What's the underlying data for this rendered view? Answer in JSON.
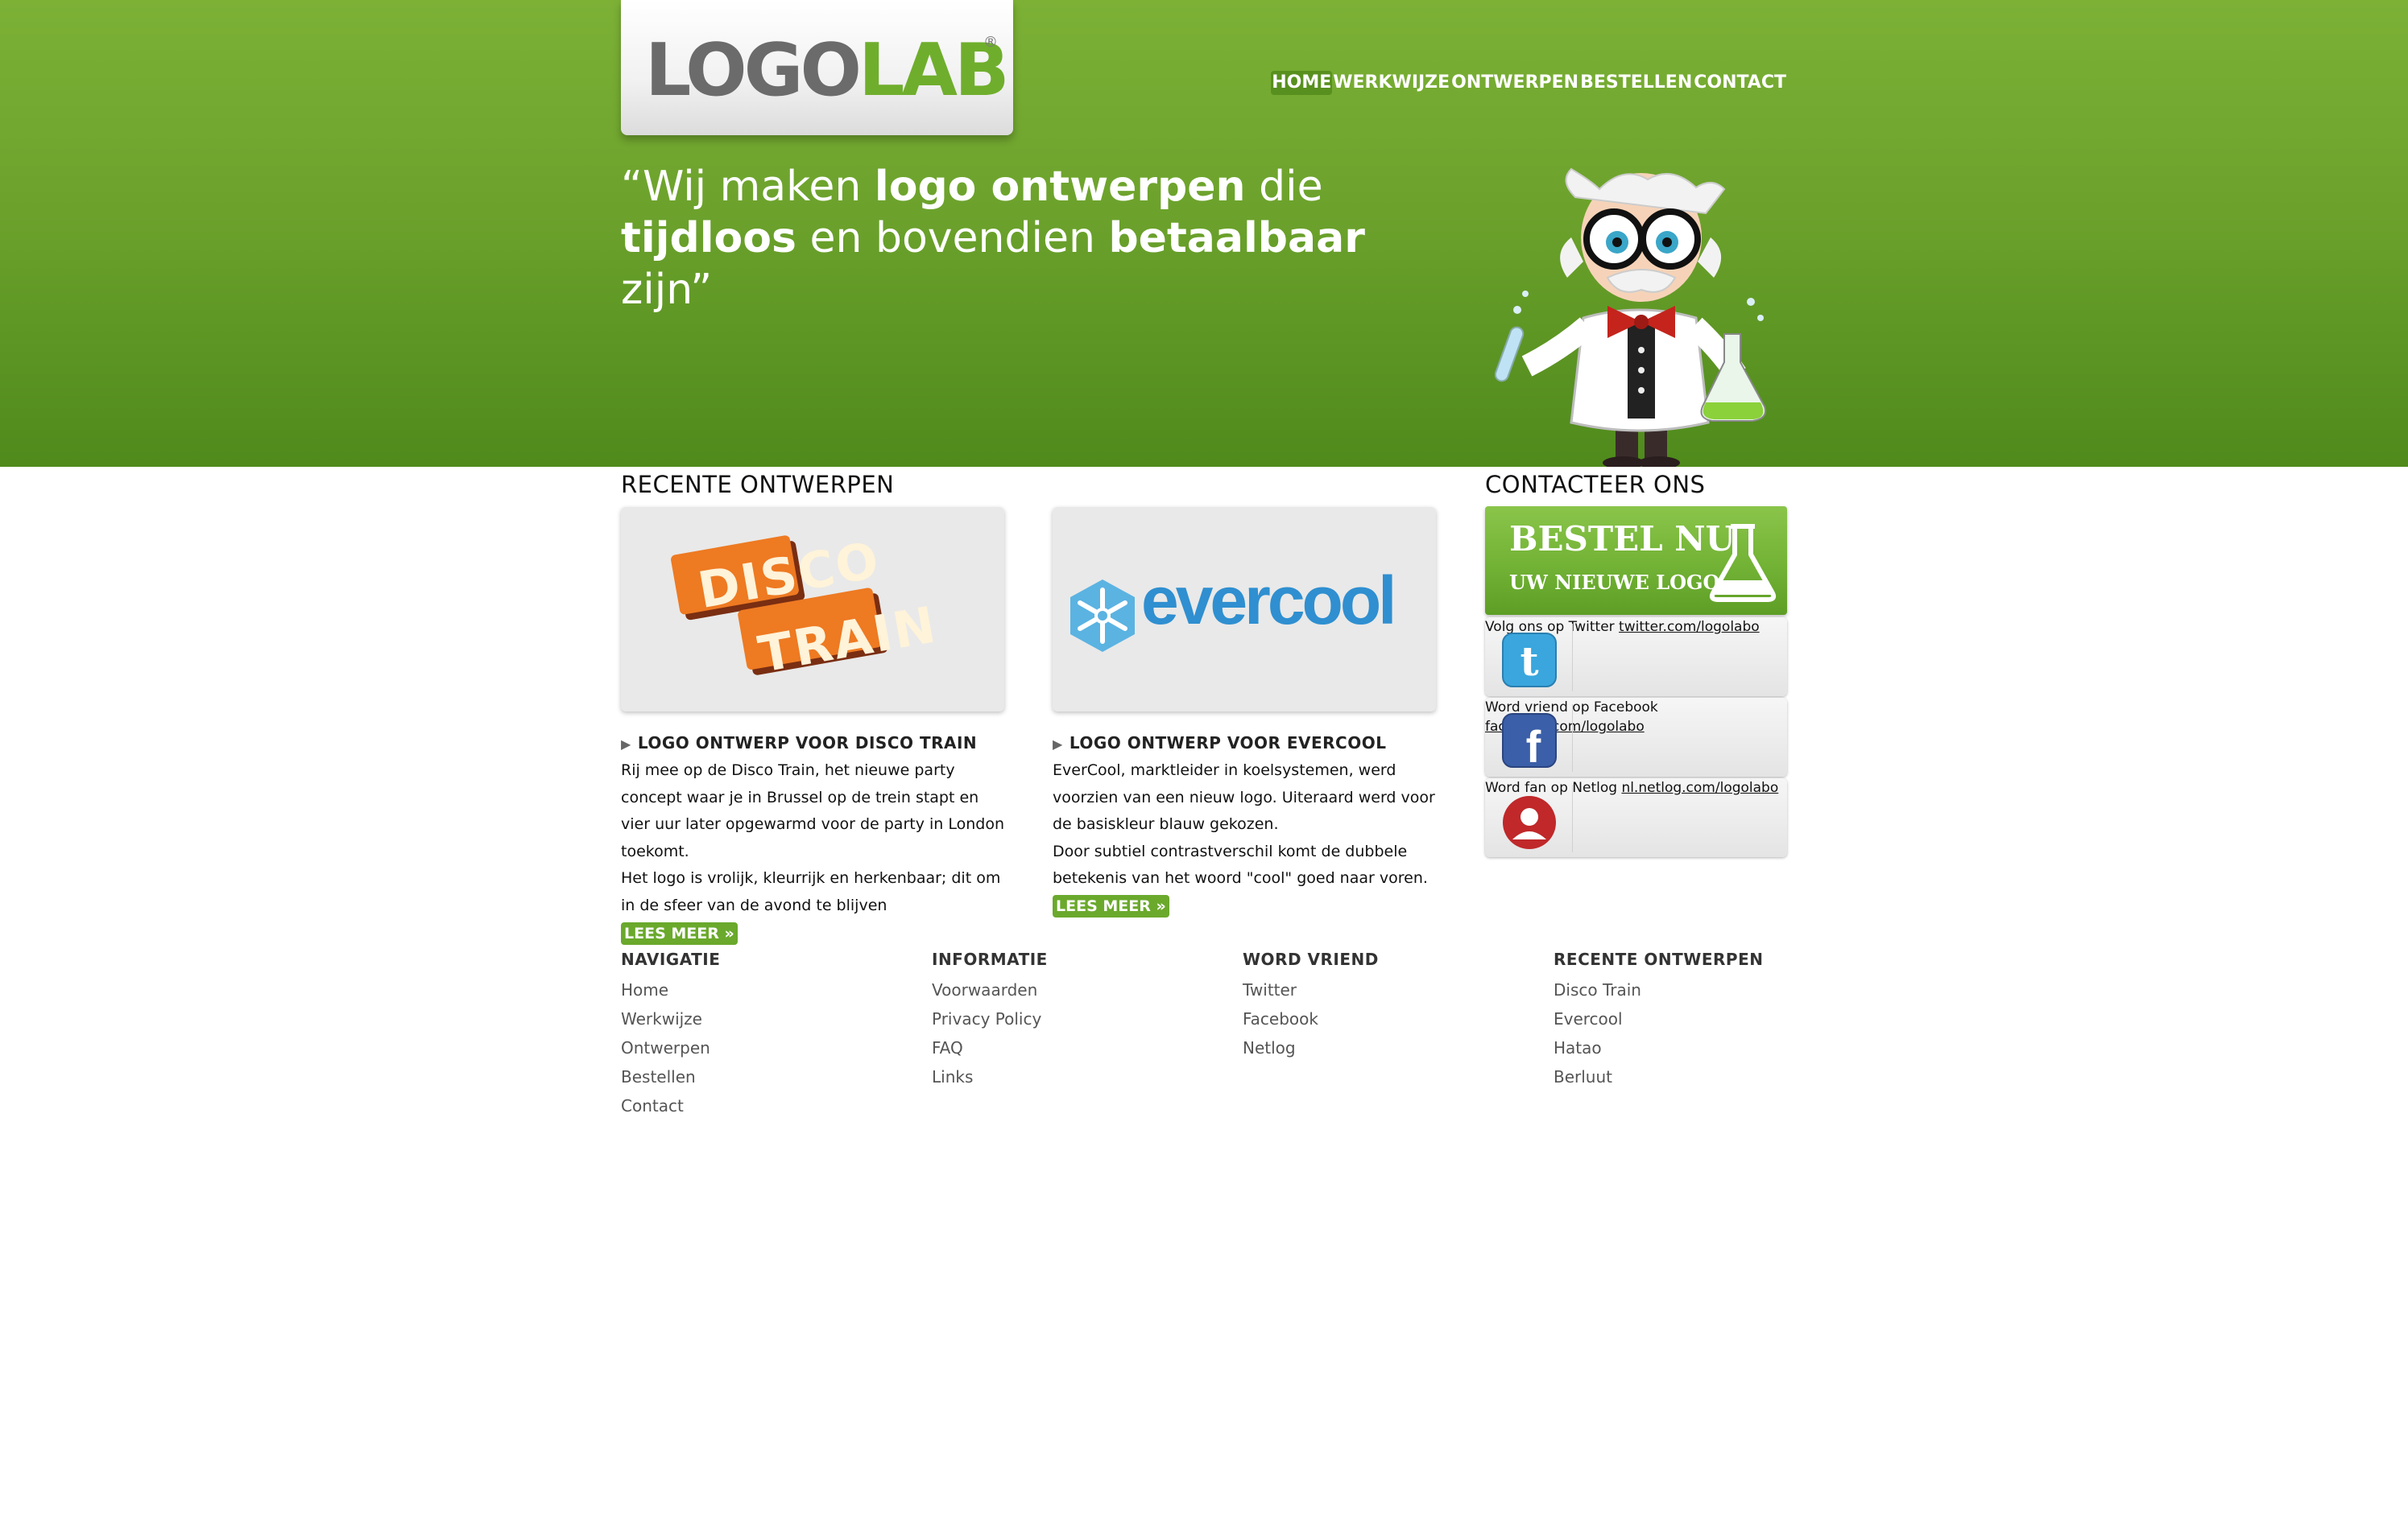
{
  "logo": {
    "part1": "LOGO",
    "part2": "LAB",
    "reg": "®"
  },
  "nav": [
    {
      "label": "HOME",
      "active": true
    },
    {
      "label": "WERKWIJZE",
      "active": false
    },
    {
      "label": "ONTWERPEN",
      "active": false
    },
    {
      "label": "BESTELLEN",
      "active": false
    },
    {
      "label": "CONTACT",
      "active": false
    }
  ],
  "tagline": {
    "t1": "“Wij maken ",
    "b1": "logo ontwerpen",
    "t2": " die",
    "b2": "tijdloos",
    "t3": " en bovendien ",
    "b3": "betaalbaar",
    "t4": " zijn”"
  },
  "recent": {
    "title": "RECENTE ONTWERPEN",
    "projects": [
      {
        "logo_line1": "DISCO",
        "logo_line2": "TRAIN",
        "title": "LOGO ONTWERP VOOR DISCO TRAIN",
        "body": [
          "Rij mee op de Disco Train, het nieuwe party concept waar je in Brussel op de trein stapt en vier uur later opgewarmd voor de party in London toekomt.",
          "Het logo is vrolijk, kleurrijk en herkenbaar; dit om in de sfeer van de avond te blijven"
        ],
        "more": "LEES MEER »"
      },
      {
        "logo_text": "evercool",
        "title": "LOGO ONTWERP VOOR EVERCOOL",
        "body": [
          "EverCool, marktleider in koelsystemen, werd voorzien van een nieuw logo. Uiteraard werd voor de basiskleur blauw gekozen.",
          "Door subtiel contrastverschil komt de dubbele betekenis van het woord \"cool\" goed naar voren."
        ],
        "more": "LEES MEER »"
      }
    ]
  },
  "contact": {
    "title": "CONTACTEER ONS",
    "bestel_line1": "BESTEL NU",
    "bestel_line2": "UW NIEUWE LOGO",
    "twitter": {
      "label": "Volg ons op Twitter ",
      "link": "twitter.com/logolabo"
    },
    "facebook": {
      "label": "Word vriend op Facebook",
      "link": "facebook.com/logolabo"
    },
    "netlog": {
      "label": "Word fan op Netlog ",
      "link": "nl.netlog.com/logolabo"
    }
  },
  "footer": {
    "navigatie": {
      "title": "NAVIGATIE",
      "links": [
        "Home",
        "Werkwijze",
        "Ontwerpen",
        "Bestellen",
        "Contact"
      ]
    },
    "informatie": {
      "title": "INFORMATIE",
      "links": [
        "Voorwaarden",
        "Privacy Policy",
        "FAQ",
        "Links"
      ]
    },
    "vriend": {
      "title": "WORD VRIEND",
      "links": [
        "Twitter",
        "Facebook",
        "Netlog"
      ]
    },
    "recente": {
      "title": "RECENTE ONTWERPEN",
      "links": [
        "Disco Train",
        "Evercool",
        "Hatao",
        "Berluut"
      ]
    }
  },
  "colors": {
    "green": "#6ca22c",
    "twitter_blue": "#3aa6dd",
    "facebook_blue": "#3b5fa8",
    "netlog_red": "#c0282a",
    "evercool_blue": "#2f8fd0",
    "disco_orange": "#ee7a22"
  }
}
